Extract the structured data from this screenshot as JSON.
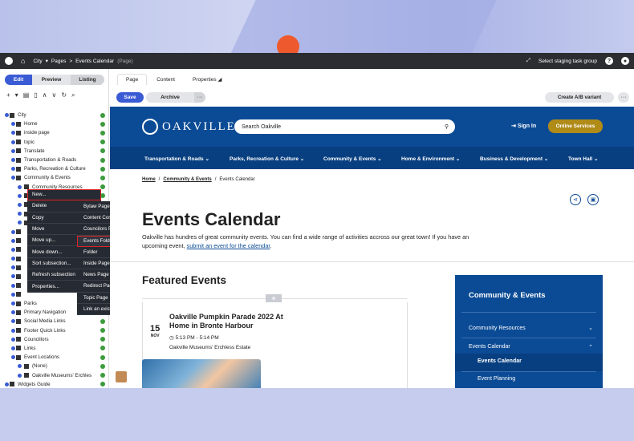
{
  "topbar": {
    "crumb_root": "City",
    "crumb_parent": "Pages",
    "crumb_sep": ">",
    "crumb_current": "Events Calendar",
    "crumb_type": "(Page)",
    "staging": "Select staging task group",
    "help": "?"
  },
  "modes": {
    "edit": "Edit",
    "preview": "Preview",
    "listing": "Listing"
  },
  "tree": [
    {
      "label": "City",
      "level": 0
    },
    {
      "label": "Home",
      "level": 1
    },
    {
      "label": "inside page",
      "level": 1
    },
    {
      "label": "topic",
      "level": 1
    },
    {
      "label": "Translate",
      "level": 1
    },
    {
      "label": "Transportation & Roads",
      "level": 1
    },
    {
      "label": "Parks, Recreation & Culture",
      "level": 1
    },
    {
      "label": "Community & Events",
      "level": 1
    },
    {
      "label": "Community Resources",
      "level": 2
    },
    {
      "label": "",
      "level": 2
    },
    {
      "label": "",
      "level": 2
    },
    {
      "label": "",
      "level": 2
    },
    {
      "label": "",
      "level": 2
    },
    {
      "label": "",
      "level": 1
    },
    {
      "label": "",
      "level": 1
    },
    {
      "label": "",
      "level": 1
    },
    {
      "label": "",
      "level": 1
    },
    {
      "label": "",
      "level": 1
    },
    {
      "label": "",
      "level": 1
    },
    {
      "label": "",
      "level": 1
    },
    {
      "label": "",
      "level": 1
    },
    {
      "label": "Parks",
      "level": 1
    },
    {
      "label": "Primary Navigation",
      "level": 1
    },
    {
      "label": "Social Media Links",
      "level": 1
    },
    {
      "label": "Footer Quick Links",
      "level": 1
    },
    {
      "label": "Councillors",
      "level": 1
    },
    {
      "label": "Links",
      "level": 1
    },
    {
      "label": "Event Locations",
      "level": 1
    },
    {
      "label": "(None)",
      "level": 2
    },
    {
      "label": "Oakville Museums' Erchles",
      "level": 2
    },
    {
      "label": "Widgets Guide",
      "level": 0
    },
    {
      "label": "E-Cubed",
      "level": 0
    }
  ],
  "context_menu": [
    "New...",
    "Delete",
    "Copy",
    "Move",
    "Move up...",
    "Move down...",
    "Sort subsection...",
    "Refresh subsection",
    "Properties..."
  ],
  "submenu": [
    "Bylaw Page",
    "Content Container",
    "Councilors Page",
    "Events Folder",
    "Folder",
    "Inside Page",
    "News Page",
    "Redirect Page",
    "Topic Page",
    "Link an existing page"
  ],
  "tabs": {
    "page": "Page",
    "content": "Content",
    "properties": "Properties"
  },
  "actions": {
    "save": "Save",
    "archive": "Archive",
    "more": "···",
    "ab": "Create A/B variant"
  },
  "site": {
    "brand": "OAKVILLE",
    "search_placeholder": "Search Oakville",
    "signin": "Sign In",
    "online": "Online Services",
    "nav": [
      "Transportation & Roads",
      "Parks, Recreation & Culture",
      "Community & Events",
      "Home & Environment",
      "Business & Development",
      "Town Hall"
    ],
    "breadcrumb": {
      "home": "Home",
      "section": "Community & Events",
      "current": "Events Calendar"
    },
    "title": "Events Calendar",
    "intro_a": "Oakville has hundres of great community events. You can find a wide range of activities accross our great town! If you have an upcoming event,",
    "intro_link": "submit an event for the calendar",
    "intro_end": ".",
    "featured": "Featured Events",
    "event": {
      "day": "15",
      "month": "NOV",
      "title": "Oakville Pumpkin Parade 2022 At Home in Bronte Harbour",
      "time": "5:13 PM - 5:14 PM",
      "location": "Oakville Museums' Erchless Estate"
    },
    "sidebar": {
      "title": "Community & Events",
      "items": [
        "Community Resources",
        "Events Calendar",
        "Events Calendar",
        "Event Planning"
      ]
    }
  }
}
